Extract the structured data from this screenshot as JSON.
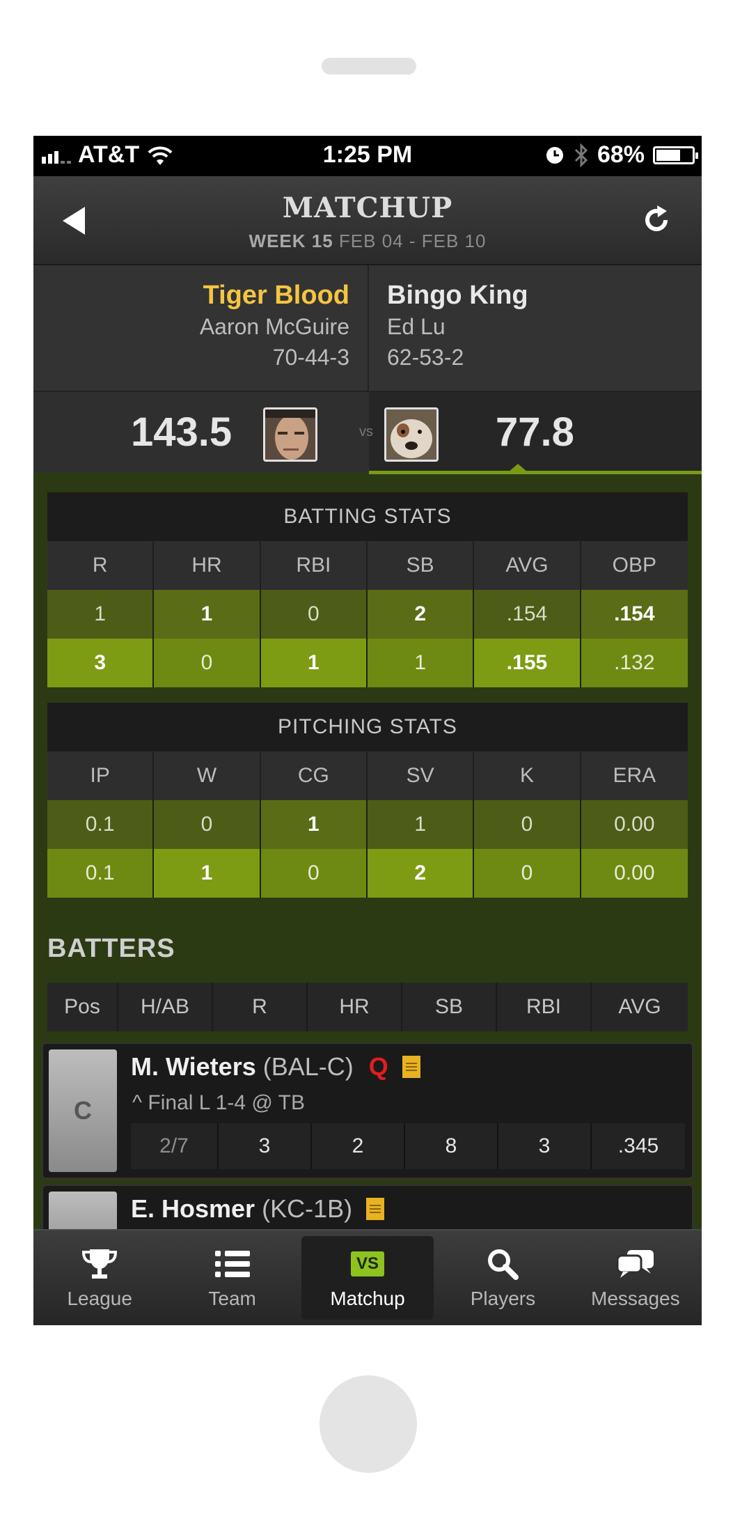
{
  "status_bar": {
    "carrier": "AT&T",
    "time": "1:25 PM",
    "battery": "68%",
    "battery_level": 0.68
  },
  "nav": {
    "title": "MATCHUP",
    "week_label": "WEEK 15",
    "date_range": "FEB 04 - FEB 10"
  },
  "team_left": {
    "name": "Tiger Blood",
    "owner": "Aaron McGuire",
    "record": "70-44-3",
    "score": "143.5"
  },
  "team_right": {
    "name": "Bingo King",
    "owner": "Ed Lu",
    "record": "62-53-2",
    "score": "77.8"
  },
  "vs_label": "vs",
  "batting": {
    "title": "BATTING STATS",
    "headers": [
      "R",
      "HR",
      "RBI",
      "SB",
      "AVG",
      "OBP"
    ],
    "rows": [
      [
        "1",
        "1",
        "0",
        "2",
        ".154",
        ".154"
      ],
      [
        "3",
        "0",
        "1",
        "1",
        ".155",
        ".132"
      ]
    ]
  },
  "pitching": {
    "title": "PITCHING STATS",
    "headers": [
      "IP",
      "W",
      "CG",
      "SV",
      "K",
      "ERA"
    ],
    "rows": [
      [
        "0.1",
        "0",
        "1",
        "1",
        "0",
        "0.00"
      ],
      [
        "0.1",
        "1",
        "0",
        "2",
        "0",
        "0.00"
      ]
    ]
  },
  "batters": {
    "section_title": "BATTERS",
    "headers": [
      "Pos",
      "H/AB",
      "R",
      "HR",
      "SB",
      "RBI",
      "AVG"
    ],
    "players": [
      {
        "pos": "C",
        "name": "M. Wieters",
        "team": "(BAL-C)",
        "status": "Q",
        "game": "^ Final L 1-4 @ TB",
        "stats": [
          "2/7",
          "3",
          "2",
          "8",
          "3",
          ".345"
        ]
      },
      {
        "pos": "",
        "name": "E. Hosmer",
        "team": "(KC-1B)"
      }
    ]
  },
  "tabs": [
    {
      "label": "League",
      "icon": "trophy-icon"
    },
    {
      "label": "Team",
      "icon": "list-icon"
    },
    {
      "label": "Matchup",
      "icon": "vs-icon",
      "badge": "VS",
      "active": true
    },
    {
      "label": "Players",
      "icon": "search-icon"
    },
    {
      "label": "Messages",
      "icon": "chat-icon"
    }
  ],
  "colors": {
    "accent_gold": "#f5c542",
    "accent_green": "#7a9a17",
    "alert_red": "#e21d1d"
  }
}
